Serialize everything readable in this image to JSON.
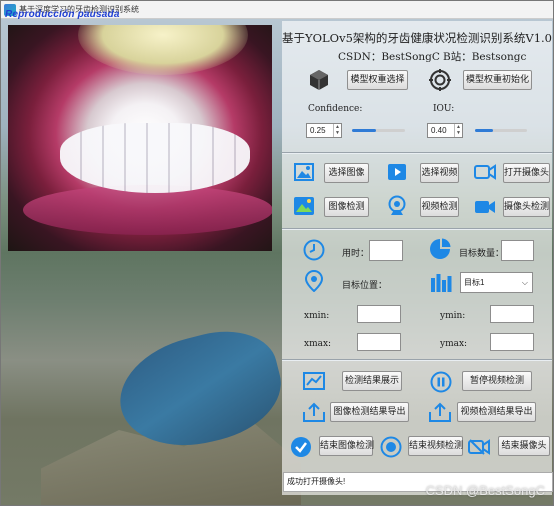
{
  "window": {
    "title": "基于深度学习的牙齿检测识别系统",
    "overlay_text": "Reproducción pausada"
  },
  "header": {
    "title": "基于YOLOv5架构的牙齿健康状况检测识别系统V1.0",
    "csdn": "CSDN：BestSongC",
    "bilibili": "B站：Bestsongc"
  },
  "model": {
    "select_label": "模型权重选择",
    "init_label": "模型权重初始化"
  },
  "params": {
    "confidence_label": "Confidence:",
    "confidence_value": "0.25",
    "iou_label": "IOU:",
    "iou_value": "0.40",
    "confidence_slider": 0.45,
    "iou_slider": 0.35
  },
  "source": {
    "select_image": "选择图像",
    "select_video": "选择视频",
    "open_camera": "打开摄像头",
    "image_detect": "图像检测",
    "video_detect": "视频检测",
    "camera_detect": "摄像头检测"
  },
  "results": {
    "time_label": "用时：",
    "count_label": "目标数量：",
    "position_label": "目标位置：",
    "target_select": "目标1",
    "xmin_label": "xmin:",
    "ymin_label": "ymin:",
    "xmax_label": "xmax:",
    "ymax_label": "ymax:"
  },
  "actions": {
    "show_results": "检测结果展示",
    "pause_video": "暂停视频检测",
    "export_image": "图像检测结果导出",
    "export_video": "视频检测结果导出",
    "end_image": "结束图像检测",
    "end_video": "结束视频检测",
    "end_camera": "结束摄像头"
  },
  "status_text": "成功打开摄像头!",
  "watermark": "CSDN @BestSongC",
  "colors": {
    "accent": "#2f7bd6",
    "icon_blue": "#1e88e5"
  }
}
